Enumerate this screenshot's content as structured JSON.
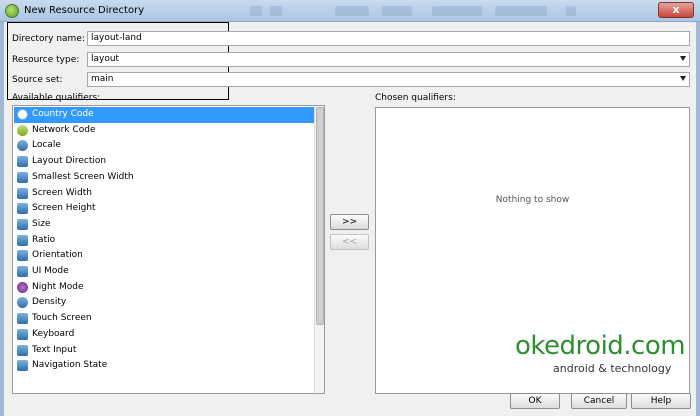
{
  "window": {
    "title": "New Resource Directory",
    "close_label": "x"
  },
  "form": {
    "directory_name": {
      "label": "Directory name:",
      "value": "layout-land"
    },
    "resource_type": {
      "label": "Resource type:",
      "value": "layout"
    },
    "source_set": {
      "label": "Source set:",
      "value": "main"
    }
  },
  "available": {
    "label": "Available qualifiers:",
    "items": [
      {
        "label": "Country Code",
        "icon": "globe-icon",
        "selected": true
      },
      {
        "label": "Network Code",
        "icon": "network-icon"
      },
      {
        "label": "Locale",
        "icon": "globe-icon"
      },
      {
        "label": "Layout Direction",
        "icon": "layout-direction-icon"
      },
      {
        "label": "Smallest Screen Width",
        "icon": "screen-width-icon"
      },
      {
        "label": "Screen Width",
        "icon": "screen-width-icon"
      },
      {
        "label": "Screen Height",
        "icon": "screen-height-icon"
      },
      {
        "label": "Size",
        "icon": "size-icon"
      },
      {
        "label": "Ratio",
        "icon": "ratio-icon"
      },
      {
        "label": "Orientation",
        "icon": "orientation-icon"
      },
      {
        "label": "UI Mode",
        "icon": "ui-mode-icon"
      },
      {
        "label": "Night Mode",
        "icon": "moon-icon"
      },
      {
        "label": "Density",
        "icon": "density-icon"
      },
      {
        "label": "Touch Screen",
        "icon": "touch-icon"
      },
      {
        "label": "Keyboard",
        "icon": "keyboard-icon"
      },
      {
        "label": "Text Input",
        "icon": "text-input-icon"
      },
      {
        "label": "Navigation State",
        "icon": "navigation-icon"
      }
    ]
  },
  "actions": {
    "add_label": ">>",
    "remove_label": "<<"
  },
  "chosen": {
    "label": "Chosen qualifiers:",
    "empty_text": "Nothing to show"
  },
  "footer": {
    "ok_label": "OK",
    "cancel_label": "Cancel",
    "help_label": "Help"
  },
  "watermark": {
    "main": "okedroid.com",
    "sub": "android & technology"
  },
  "colors": {
    "selection": "#3399ff",
    "watermark": "#2f8f2f"
  }
}
